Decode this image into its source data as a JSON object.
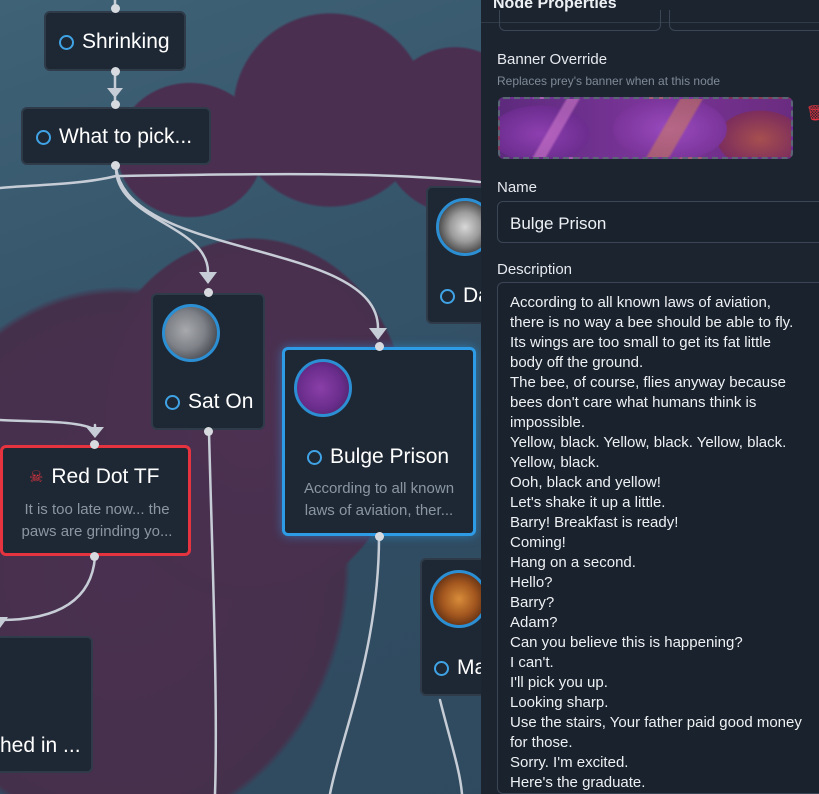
{
  "nodes": {
    "shrinking": {
      "label": "Shrinking"
    },
    "what_to_pick": {
      "label": "What to pick..."
    },
    "sat_on": {
      "label": "Sat On"
    },
    "bulge_prison": {
      "label": "Bulge Prison",
      "desc_line1": "According to all known",
      "desc_line2": "laws of aviation, ther..."
    },
    "red_dot_tf": {
      "label": "Red Dot TF",
      "desc_line1": "It is too late now... the",
      "desc_line2": "paws are grinding yo..."
    },
    "da_partial": {
      "label": "Da"
    },
    "ma_partial": {
      "label": "Ma"
    },
    "bottom_left_partial": {
      "label": "hed in ..."
    }
  },
  "panel": {
    "header": "Node Properties",
    "banner_label": "Banner Override",
    "banner_hint": "Replaces prey's banner when at this node",
    "name_label": "Name",
    "name_value": "Bulge Prison",
    "description_label": "Description",
    "description_lines": [
      "According to all known laws of aviation,",
      "there is no way a bee should be able to fly.",
      "Its wings are too small to get its fat little",
      "body off the ground.",
      "The bee, of course, flies anyway because",
      "bees don't care what humans think is",
      "impossible.",
      "Yellow, black. Yellow, black. Yellow, black.",
      "Yellow, black.",
      "Ooh, black and yellow!",
      "Let's shake it up a little.",
      "Barry! Breakfast is ready!",
      "Coming!",
      "Hang on a second.",
      "Hello?",
      "Barry?",
      "Adam?",
      "Can you believe this is happening?",
      "I can't.",
      "I'll pick you up.",
      "Looking sharp.",
      "Use the stairs, Your father paid good money",
      "for those.",
      "Sorry. I'm excited.",
      "Here's the graduate."
    ]
  },
  "icons": {
    "node_ring": "circle-outline-icon",
    "red_dot": "skull-icon",
    "delete": "trash-icon"
  },
  "colors": {
    "accent": "#3fa3e6",
    "selected_border": "#2e9be6",
    "danger_border": "#e5333f",
    "node_bg": "#1e2834",
    "panel_bg": "#1c2430"
  }
}
